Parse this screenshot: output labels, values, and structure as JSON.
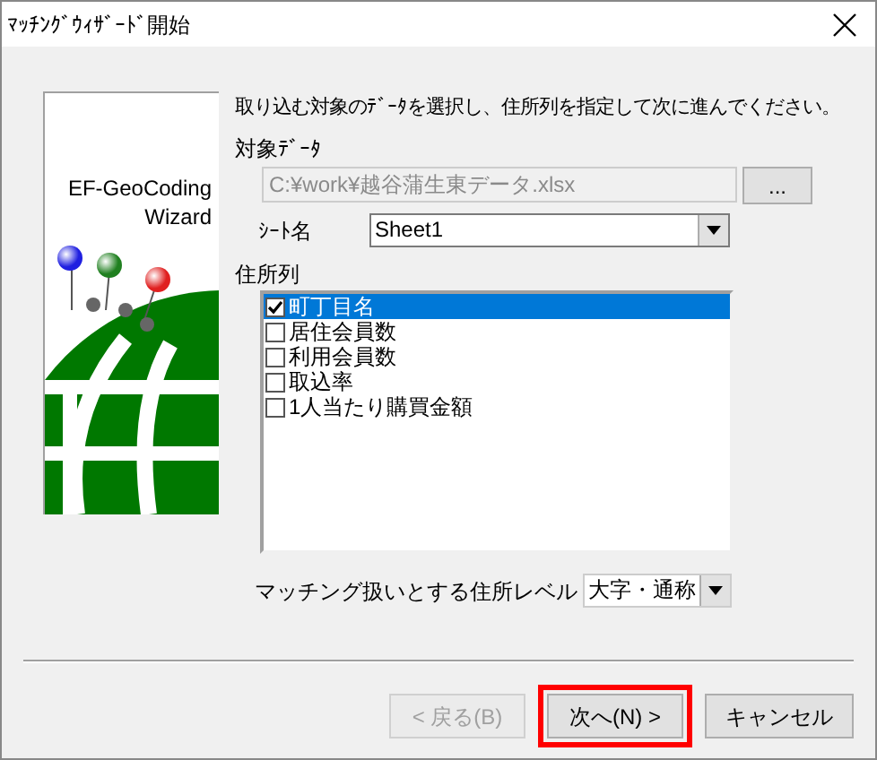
{
  "window": {
    "title": "ﾏｯﾁﾝｸﾞｳｨｻﾞｰﾄﾞ開始"
  },
  "logo": {
    "line_1": "EF-GeoCoding",
    "line_2": "Wizard"
  },
  "instruction": "取り込む対象のﾃﾞｰﾀを選択し、住所列を指定して次に進んでください。",
  "target_data": {
    "label": "対象ﾃﾞｰﾀ",
    "value": "C:¥work¥越谷蒲生東データ.xlsx",
    "disabled": true,
    "browse_button": "..."
  },
  "sheet": {
    "label": "ｼｰﾄ名",
    "value": "Sheet1"
  },
  "address_columns": {
    "label": "住所列",
    "items": [
      {
        "label": "町丁目名",
        "checked": true,
        "selected": true
      },
      {
        "label": "居住会員数",
        "checked": false,
        "selected": false
      },
      {
        "label": "利用会員数",
        "checked": false,
        "selected": false
      },
      {
        "label": "取込率",
        "checked": false,
        "selected": false
      },
      {
        "label": "1人当たり購買金額",
        "checked": false,
        "selected": false
      }
    ]
  },
  "matching_level": {
    "label": "マッチング扱いとする住所レベル",
    "value": "大字・通称"
  },
  "buttons": [
    {
      "label": "< 戻る(B)",
      "disabled": true,
      "highlighted": false
    },
    {
      "label": "次へ(N) >",
      "disabled": false,
      "highlighted": true
    },
    {
      "label": "キャンセル",
      "disabled": false,
      "highlighted": false
    }
  ]
}
